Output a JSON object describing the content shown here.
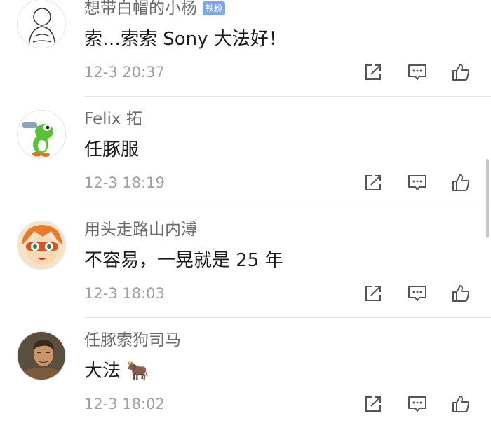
{
  "comments": [
    {
      "username": "想带白帽的小杨",
      "badge": "铁粉",
      "content": "索…索索 Sony 大法好！",
      "time": "12-3 20:37",
      "avatar_icon": "sketch-figure-avatar"
    },
    {
      "username": "Felix 拓",
      "badge": "",
      "content": "任豚服",
      "time": "12-3 18:19",
      "avatar_icon": "green-yoshi-avatar"
    },
    {
      "username": "用头走路山内溥",
      "badge": "",
      "content": "不容易，一晃就是 25 年",
      "time": "12-3 18:03",
      "avatar_icon": "anime-character-avatar"
    },
    {
      "username": "任豚索狗司马",
      "badge": "",
      "content": "大法 🐂",
      "time": "12-3 18:02",
      "avatar_icon": "game-hero-avatar"
    }
  ],
  "icons": {
    "share": "share-icon",
    "reply": "comment-icon",
    "like": "thumbs-up-icon"
  },
  "colors": {
    "username": "#6b6b6b",
    "content": "#1a1a1a",
    "time": "#a0a0a0",
    "badge": "#7aa8e8",
    "icon": "#555555"
  }
}
